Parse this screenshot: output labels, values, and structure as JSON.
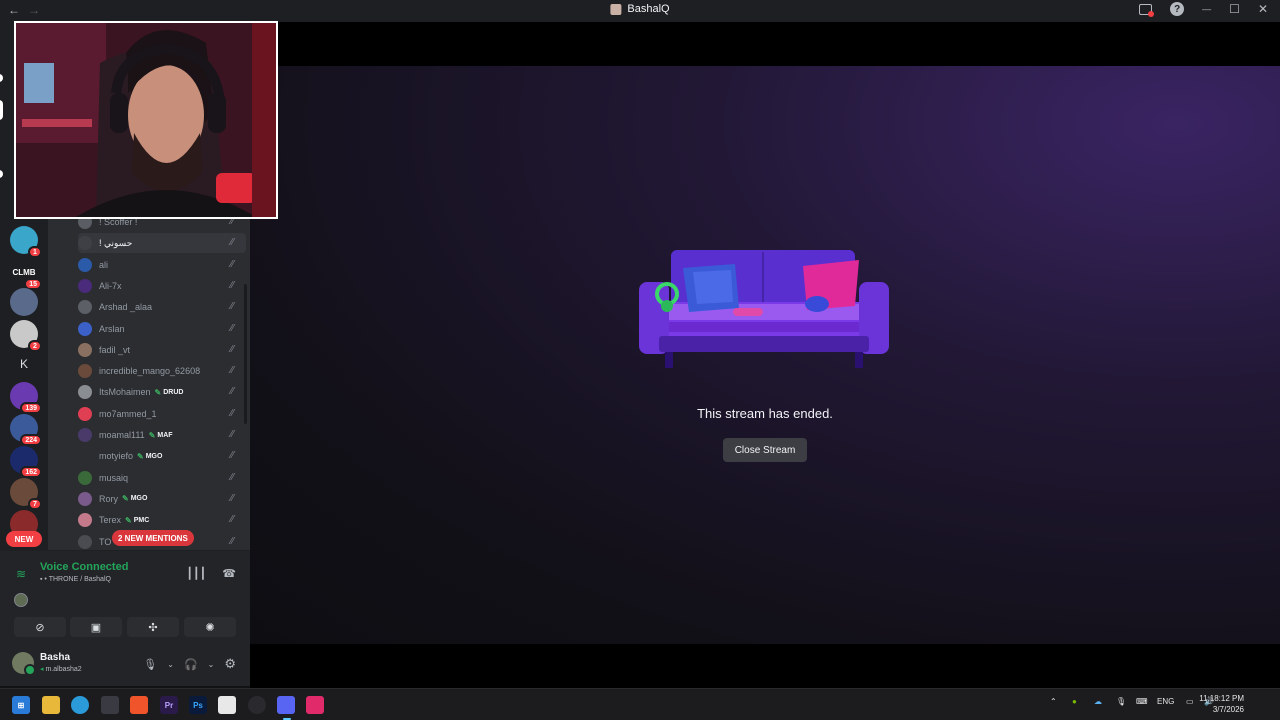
{
  "titlebar": {
    "back": "←",
    "forward": "→",
    "title": "BashalQ",
    "help": "?",
    "minimize": "—",
    "maximize": "☐",
    "close": "✕"
  },
  "servers": {
    "badges": [
      "1",
      "15",
      "2",
      "139",
      "224",
      "162",
      "7"
    ],
    "letter_server": "K",
    "server_wordmark": "CLMB",
    "new_label": "NEW"
  },
  "members": [
    {
      "name": "! Scoffer !",
      "color": "#5a5d63",
      "tag": "",
      "state": "normal"
    },
    {
      "name": "! حسوني",
      "color": "#3e4046",
      "tag": "",
      "state": "hover"
    },
    {
      "name": "ali",
      "color": "#2b5aa8",
      "tag": "",
      "state": "normal"
    },
    {
      "name": "Ali-7x",
      "color": "#4a2a7a",
      "tag": "",
      "state": "normal"
    },
    {
      "name": "Arshad _alaa",
      "color": "#5c5f66",
      "tag": "",
      "state": "normal"
    },
    {
      "name": "Arslan",
      "color": "#3b61c9",
      "tag": "",
      "state": "normal"
    },
    {
      "name": "fadil _vt",
      "color": "#8a7060",
      "tag": "",
      "state": "normal"
    },
    {
      "name": "incredible_mango_62608",
      "color": "#6a4a3a",
      "tag": "",
      "state": "normal"
    },
    {
      "name": "ItsMohaimen",
      "color": "#8a8d92",
      "tag": "DRUD",
      "state": "normal"
    },
    {
      "name": "mo7ammed_1",
      "color": "#e03e52",
      "tag": "",
      "state": "normal"
    },
    {
      "name": "moamal111",
      "color": "#4a3a6a",
      "tag": "MAF",
      "state": "normal"
    },
    {
      "name": "motyiefo",
      "color": "#2b2d31",
      "tag": "MGO",
      "state": "normal"
    },
    {
      "name": "musaiq",
      "color": "#3a6a3a",
      "tag": "",
      "state": "normal"
    },
    {
      "name": "Rory",
      "color": "#7a5a8a",
      "tag": "MGO",
      "state": "normal"
    },
    {
      "name": "Terex",
      "color": "#c47a8a",
      "tag": "PMC",
      "state": "normal"
    },
    {
      "name": "TO",
      "color": "#4a4c52",
      "tag": "",
      "state": "normal"
    }
  ],
  "mentions_pill": "2 NEW MENTIONS",
  "voice": {
    "title": "Voice Connected",
    "channel": "THRONE / BashalQ"
  },
  "user": {
    "name": "Basha",
    "status": "m.albasha2"
  },
  "stage": {
    "message": "This stream has ended.",
    "close_label": "Close Stream"
  },
  "taskbar": {
    "lang": "ENG",
    "time": "11:18:12 PM",
    "date": "3/7/2026"
  }
}
